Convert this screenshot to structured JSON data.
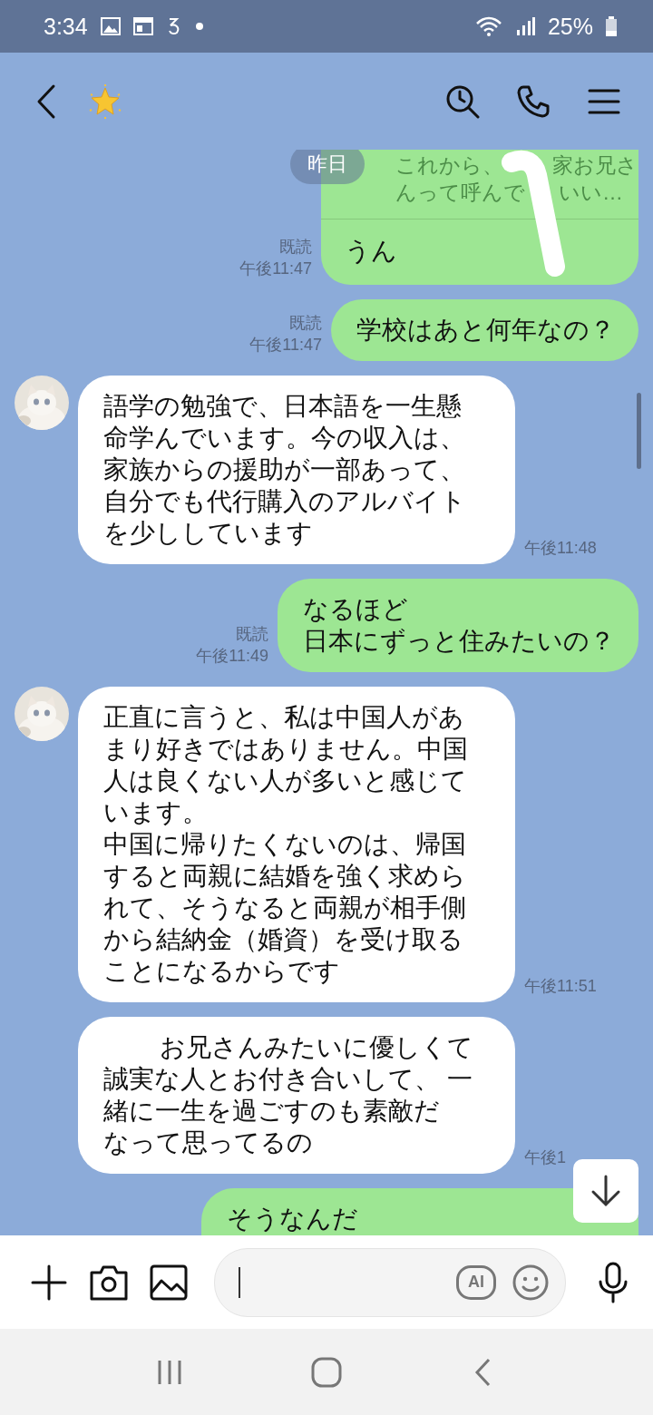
{
  "status_bar": {
    "time": "3:34",
    "battery": "25%"
  },
  "date_chip": "昨日",
  "messages": [
    {
      "kind": "quote_reply",
      "quote_lines": [
        [
          "これから、",
          "家お兄さ"
        ],
        [
          "んって呼んで",
          "いい…"
        ]
      ],
      "lines": [
        "うん"
      ],
      "read": "既読",
      "time": "午後11:47"
    },
    {
      "kind": "sent",
      "lines": [
        "学校はあと何年なの？"
      ],
      "read": "既読",
      "time": "午後11:47"
    },
    {
      "kind": "received",
      "avatar": true,
      "lines": [
        "語学の勉強で、日本語を一生懸",
        "命学んでいます。今の収入は、",
        "家族からの援助が一部あって、",
        "自分でも代行購入のアルバイト",
        "を少ししています"
      ],
      "time": "午後11:48"
    },
    {
      "kind": "sent",
      "lines": [
        "なるほど",
        "日本にずっと住みたいの？"
      ],
      "read": "既読",
      "time": "午後11:49"
    },
    {
      "kind": "received",
      "avatar": true,
      "lines": [
        "正直に言うと、私は中国人があ",
        "まり好きではありません。中国",
        "人は良くない人が多いと感じて",
        "います。",
        "中国に帰りたくないのは、帰国",
        "すると両親に結婚を強く求めら",
        "れて、そうなると両親が相手側",
        "から結納金（婚資）を受け取る",
        "ことになるからです"
      ],
      "time": "午後11:51"
    },
    {
      "kind": "received",
      "avatar": false,
      "redacted": true,
      "lines": [
        "お兄さんみたいに優しくて",
        "誠実な人とお付き合いして、 一",
        "緒に一生を過ごすのも素敵だ",
        "なって思ってるの"
      ],
      "time": "午後1"
    },
    {
      "kind": "sent",
      "cut": true,
      "lines": [
        "そうなんだ"
      ]
    }
  ],
  "input": {
    "ai_label": "AI"
  }
}
